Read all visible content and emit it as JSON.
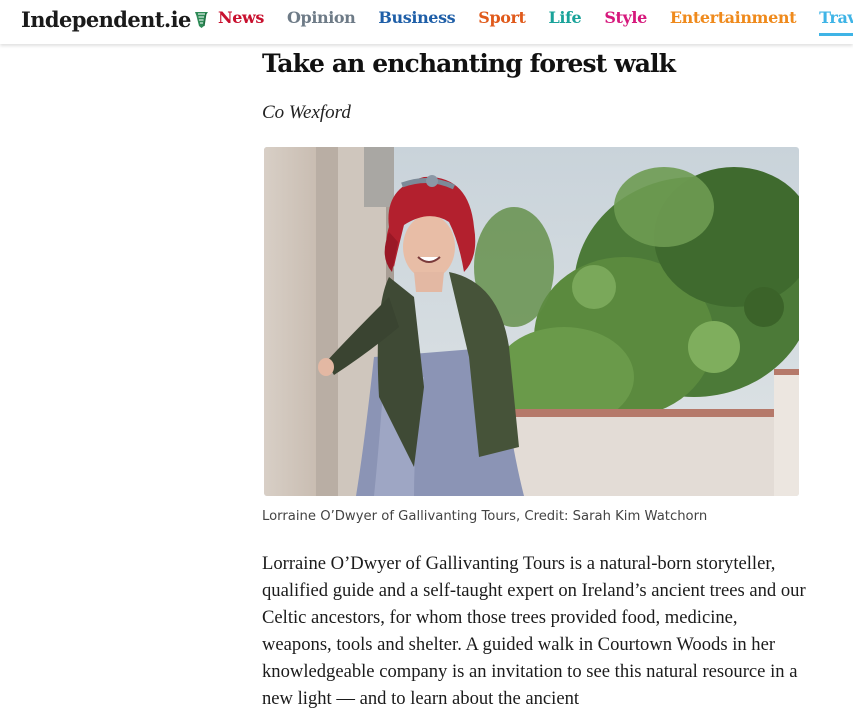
{
  "header": {
    "logo_text": "Independent.ie",
    "logo_icon": "harp-icon",
    "nav": [
      {
        "label": "News",
        "color": "#c8102e",
        "active": false
      },
      {
        "label": "Opinion",
        "color": "#6e7b87",
        "active": false
      },
      {
        "label": "Business",
        "color": "#1f5fa8",
        "active": false
      },
      {
        "label": "Sport",
        "color": "#e05a1b",
        "active": false
      },
      {
        "label": "Life",
        "color": "#1aa39a",
        "active": false
      },
      {
        "label": "Style",
        "color": "#d6187c",
        "active": false
      },
      {
        "label": "Entertainment",
        "color": "#ef8a1c",
        "active": false
      },
      {
        "label": "Travel",
        "color": "#3fb4e6",
        "active": true
      }
    ]
  },
  "article": {
    "headline": "Take an enchanting forest walk",
    "location": "Co Wexford",
    "image_caption": "Lorraine O’Dwyer of Gallivanting Tours, Credit: Sarah Kim Watchorn",
    "body": "Lorraine O’Dwyer of Gallivanting Tours is a natural-born storyteller, qualified guide and a self-taught expert on Ireland’s ancient trees and our Celtic ancestors, for whom those trees provided food, medicine, weapons, tools and shelter. A guided walk in Courtown Woods in her knowledgeable company is an invitation to see this natural resource in a new light — and to learn about the ancient"
  }
}
